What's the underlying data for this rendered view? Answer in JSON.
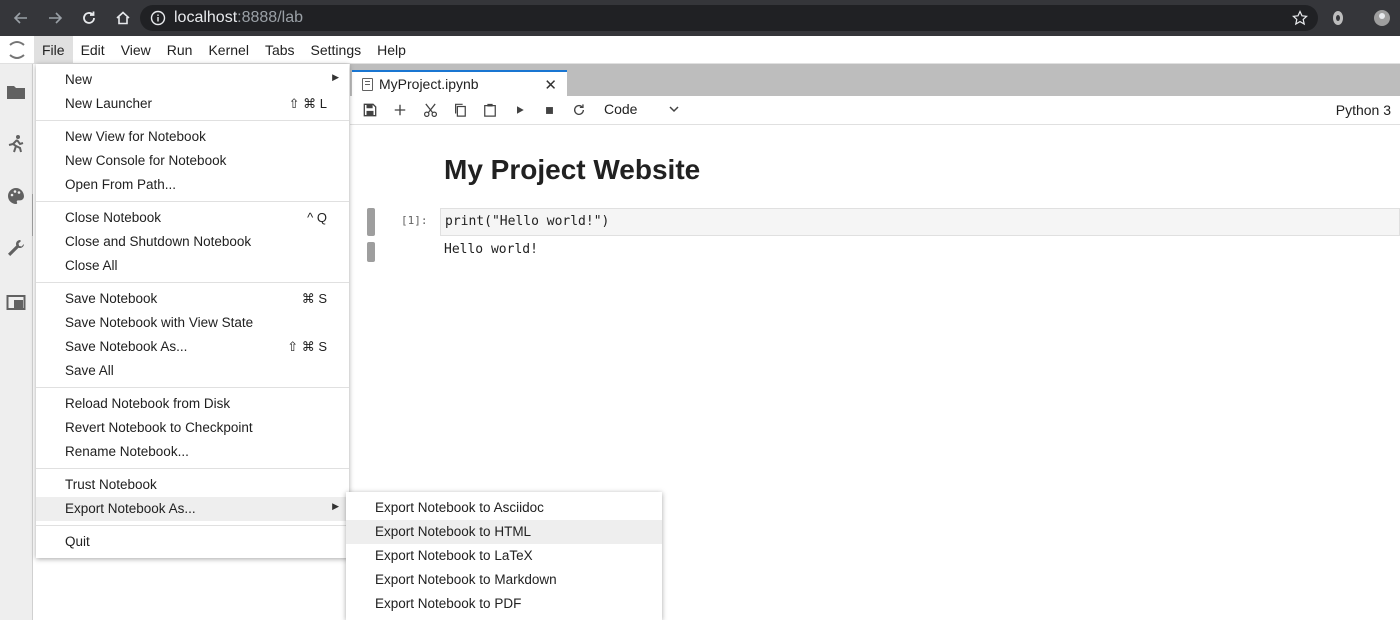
{
  "browser": {
    "url_host": "localhost",
    "url_rest": ":8888/lab"
  },
  "menubar": {
    "items": [
      "File",
      "Edit",
      "View",
      "Run",
      "Kernel",
      "Tabs",
      "Settings",
      "Help"
    ]
  },
  "tab": {
    "label": "MyProject.ipynb",
    "close": "✕"
  },
  "toolbar": {
    "cell_type": "Code",
    "kernel": "Python 3"
  },
  "notebook": {
    "heading": "My Project Website",
    "prompt": "[1]:",
    "code": "print(\"Hello world!\")",
    "output": "Hello world!"
  },
  "file_menu": {
    "items": [
      {
        "label": "New",
        "shortcut": "",
        "arrow": "▶"
      },
      {
        "label": "New Launcher",
        "shortcut": "⇧ ⌘ L"
      },
      {
        "label": "New View for Notebook",
        "shortcut": ""
      },
      {
        "label": "New Console for Notebook",
        "shortcut": ""
      },
      {
        "label": "Open From Path...",
        "shortcut": ""
      },
      {
        "label": "Close Notebook",
        "shortcut": "^ Q"
      },
      {
        "label": "Close and Shutdown Notebook",
        "shortcut": ""
      },
      {
        "label": "Close All",
        "shortcut": ""
      },
      {
        "label": "Save Notebook",
        "shortcut": "⌘ S"
      },
      {
        "label": "Save Notebook with View State",
        "shortcut": ""
      },
      {
        "label": "Save Notebook As...",
        "shortcut": "⇧ ⌘ S"
      },
      {
        "label": "Save All",
        "shortcut": ""
      },
      {
        "label": "Reload Notebook from Disk",
        "shortcut": ""
      },
      {
        "label": "Revert Notebook to Checkpoint",
        "shortcut": ""
      },
      {
        "label": "Rename Notebook...",
        "shortcut": ""
      },
      {
        "label": "Trust Notebook",
        "shortcut": ""
      },
      {
        "label": "Export Notebook As...",
        "shortcut": "",
        "arrow": "▶"
      },
      {
        "label": "Quit",
        "shortcut": ""
      }
    ]
  },
  "export_menu": {
    "items": [
      {
        "label": "Export Notebook to Asciidoc"
      },
      {
        "label": "Export Notebook to HTML"
      },
      {
        "label": "Export Notebook to LaTeX"
      },
      {
        "label": "Export Notebook to Markdown"
      },
      {
        "label": "Export Notebook to PDF"
      }
    ]
  },
  "colors": {
    "chrome_bg": "#35363a",
    "accent": "#1976d2",
    "hover": "#eeeeee"
  }
}
